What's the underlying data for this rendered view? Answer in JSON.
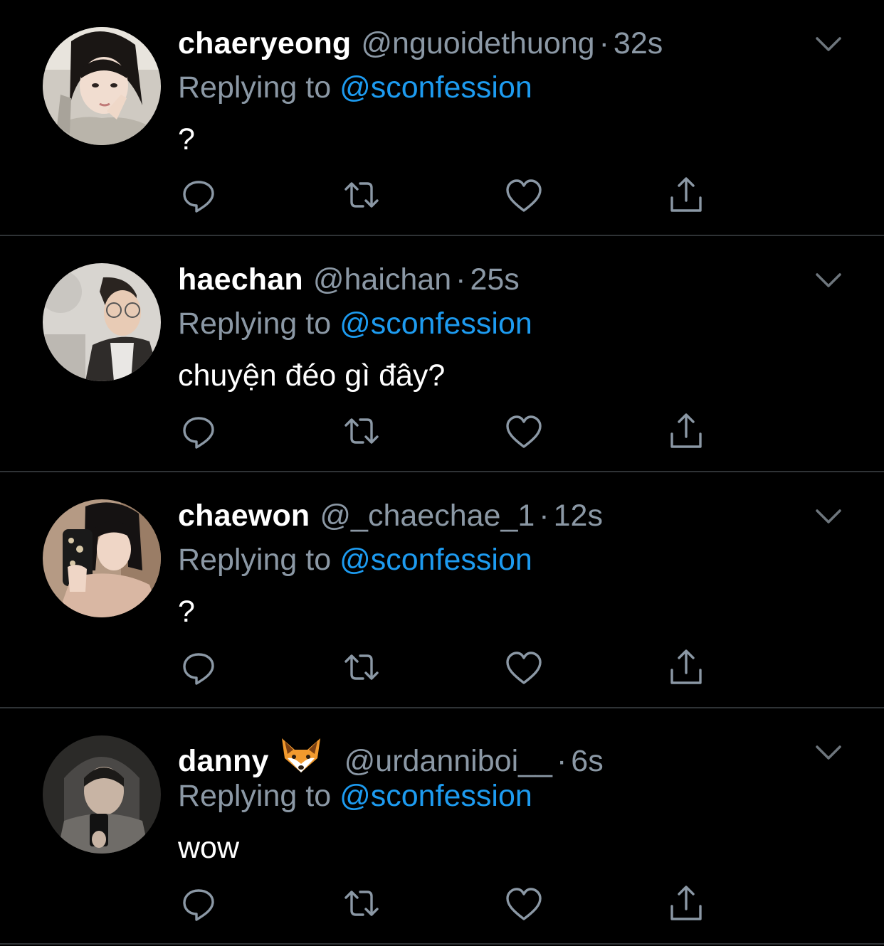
{
  "theme": {
    "background": "#000000",
    "divider": "#2f3336",
    "text_primary": "#ffffff",
    "text_secondary": "#8b98a5",
    "accent": "#1d9bf0"
  },
  "icons": {
    "reply": "reply-icon",
    "retweet": "retweet-icon",
    "like": "heart-icon",
    "share": "share-icon",
    "menu": "chevron-down-icon"
  },
  "replies": [
    {
      "display_name": "chaeryeong",
      "handle": "@nguoidethuong",
      "separator": "·",
      "time": "32s",
      "replying_prefix": "Replying to",
      "replying_to": "@sconfession",
      "text": "?"
    },
    {
      "display_name": "haechan",
      "handle": "@haichan",
      "separator": "·",
      "time": "25s",
      "replying_prefix": "Replying to",
      "replying_to": "@sconfession",
      "text": "chuyện đéo gì đây?"
    },
    {
      "display_name": "chaewon",
      "handle": "@_chaechae_1",
      "separator": "·",
      "time": "12s",
      "replying_prefix": "Replying to",
      "replying_to": "@sconfession",
      "text": "?"
    },
    {
      "display_name": "danny",
      "name_emoji": "fox-face-emoji",
      "handle": "@urdanniboi__",
      "separator": "·",
      "time": "6s",
      "replying_prefix": "Replying to",
      "replying_to": "@sconfession",
      "text": "wow"
    }
  ]
}
